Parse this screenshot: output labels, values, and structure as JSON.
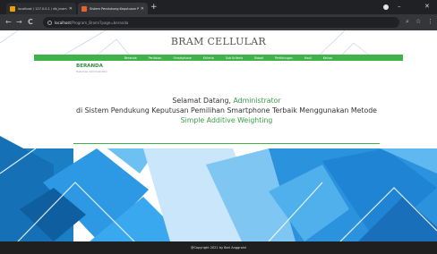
{
  "browser": {
    "tabs": [
      {
        "title": "localhost / 127.0.0.1 / db_bram",
        "favicon_color": "#f0a000"
      },
      {
        "title": "Sistem Pendukung Keputusan Pe",
        "favicon_color": "#e8622a"
      }
    ],
    "new_tab_glyph": "+",
    "window_controls": {
      "minimize": "–",
      "close": "✕"
    },
    "nav": {
      "back": "←",
      "forward": "→",
      "reload": "C"
    },
    "url": {
      "host": "localhost",
      "path": "/Program_Bram/?page=beranda"
    },
    "icons": {
      "zoom": "⌕",
      "star": "☆",
      "menu": "⋮"
    }
  },
  "site": {
    "title": "BRAM CELLULAR",
    "menu": [
      "Beranda",
      "Penilaian",
      "Smartphone",
      "Kriteria",
      "Sub Kriteria",
      "Bobot",
      "Perhitungan",
      "Hasil",
      "Keluar"
    ]
  },
  "breadcrumb": {
    "title": "BERANDA",
    "subtitle": "Halaman Administrator"
  },
  "welcome": {
    "greeting": "Selamat Datang, ",
    "user": "Administrator",
    "line2": "di Sistem Pendukung Keputusan Pemilihan Smartphone Terbaik Menggunakan Metode",
    "method": "Simple Additive Weighting"
  },
  "footer": {
    "text": "@Copyright 2021 by Bari Anggraini"
  },
  "colors": {
    "accent_green": "#3fb24a",
    "text_green": "#3a9d4a",
    "chrome_dark": "#202124",
    "footer_bg": "#1f1f1f",
    "poly_blue": "#1f8fe0"
  }
}
